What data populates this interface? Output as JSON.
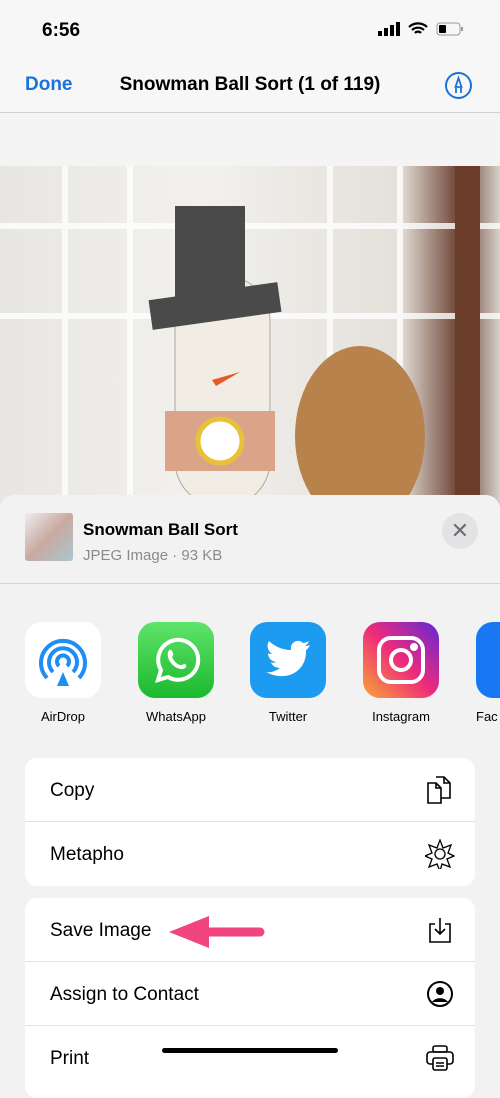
{
  "status": {
    "time": "6:56"
  },
  "nav": {
    "done": "Done",
    "title": "Snowman Ball Sort (1 of 119)",
    "markup_icon": "markup-pen-icon"
  },
  "sheet": {
    "file_name": "Snowman Ball Sort",
    "file_info": "JPEG Image · 93 KB",
    "apps": [
      {
        "label": "AirDrop"
      },
      {
        "label": "WhatsApp"
      },
      {
        "label": "Twitter"
      },
      {
        "label": "Instagram"
      },
      {
        "label": "Fac"
      }
    ],
    "group1": [
      {
        "label": "Copy",
        "icon": "copy-icon"
      },
      {
        "label": "Metapho",
        "icon": "metapho-icon"
      }
    ],
    "group2": [
      {
        "label": "Save Image",
        "icon": "save-download-icon"
      },
      {
        "label": "Assign to Contact",
        "icon": "contact-icon"
      },
      {
        "label": "Print",
        "icon": "printer-icon"
      }
    ]
  },
  "colors": {
    "accent": "#1a73d9",
    "arrow": "#f0457e"
  }
}
